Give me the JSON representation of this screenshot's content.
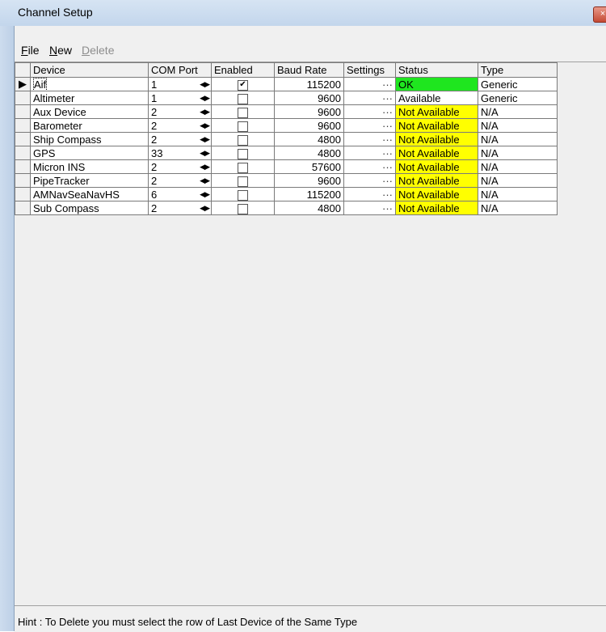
{
  "window": {
    "title": "Channel Setup",
    "close_glyph": "×"
  },
  "menu": {
    "items": [
      {
        "label": "File",
        "underline": "F",
        "rest": "ile",
        "enabled": true
      },
      {
        "label": "New",
        "underline": "N",
        "rest": "ew",
        "enabled": true
      },
      {
        "label": "Delete",
        "underline": "D",
        "rest": "elete",
        "enabled": false
      }
    ]
  },
  "grid": {
    "columns": [
      "Device",
      "COM Port",
      "Enabled",
      "Baud Rate",
      "Settings",
      "Status",
      "Type"
    ],
    "settings_glyph": "···",
    "rows": [
      {
        "device": "Aif",
        "com": "1",
        "enabled": true,
        "baud": "115200",
        "status": "OK",
        "status_kind": "ok",
        "type": "Generic",
        "selected": true
      },
      {
        "device": "Altimeter",
        "com": "1",
        "enabled": false,
        "baud": "9600",
        "status": "Available",
        "status_kind": "plain",
        "type": "Generic"
      },
      {
        "device": "Aux Device",
        "com": "2",
        "enabled": false,
        "baud": "9600",
        "status": "Not Available",
        "status_kind": "na",
        "type": "N/A"
      },
      {
        "device": "Barometer",
        "com": "2",
        "enabled": false,
        "baud": "9600",
        "status": "Not Available",
        "status_kind": "na",
        "type": "N/A"
      },
      {
        "device": "Ship Compass",
        "com": "2",
        "enabled": false,
        "baud": "4800",
        "status": "Not Available",
        "status_kind": "na",
        "type": "N/A"
      },
      {
        "device": "GPS",
        "com": "33",
        "enabled": false,
        "baud": "4800",
        "status": "Not Available",
        "status_kind": "na",
        "type": "N/A"
      },
      {
        "device": "Micron INS",
        "com": "2",
        "enabled": false,
        "baud": "57600",
        "status": "Not Available",
        "status_kind": "na",
        "type": "N/A"
      },
      {
        "device": "PipeTracker",
        "com": "2",
        "enabled": false,
        "baud": "9600",
        "status": "Not Available",
        "status_kind": "na",
        "type": "N/A"
      },
      {
        "device": "AMNavSeaNavHS",
        "com": "6",
        "enabled": false,
        "baud": "115200",
        "status": "Not Available",
        "status_kind": "na",
        "type": "N/A"
      },
      {
        "device": "Sub Compass",
        "com": "2",
        "enabled": false,
        "baud": "4800",
        "status": "Not Available",
        "status_kind": "na",
        "type": "N/A"
      }
    ]
  },
  "hint": "Hint : To Delete you must select the row of Last Device of the Same Type",
  "colors": {
    "status_ok": "#1fe61f",
    "status_not_available": "#ffff00"
  }
}
